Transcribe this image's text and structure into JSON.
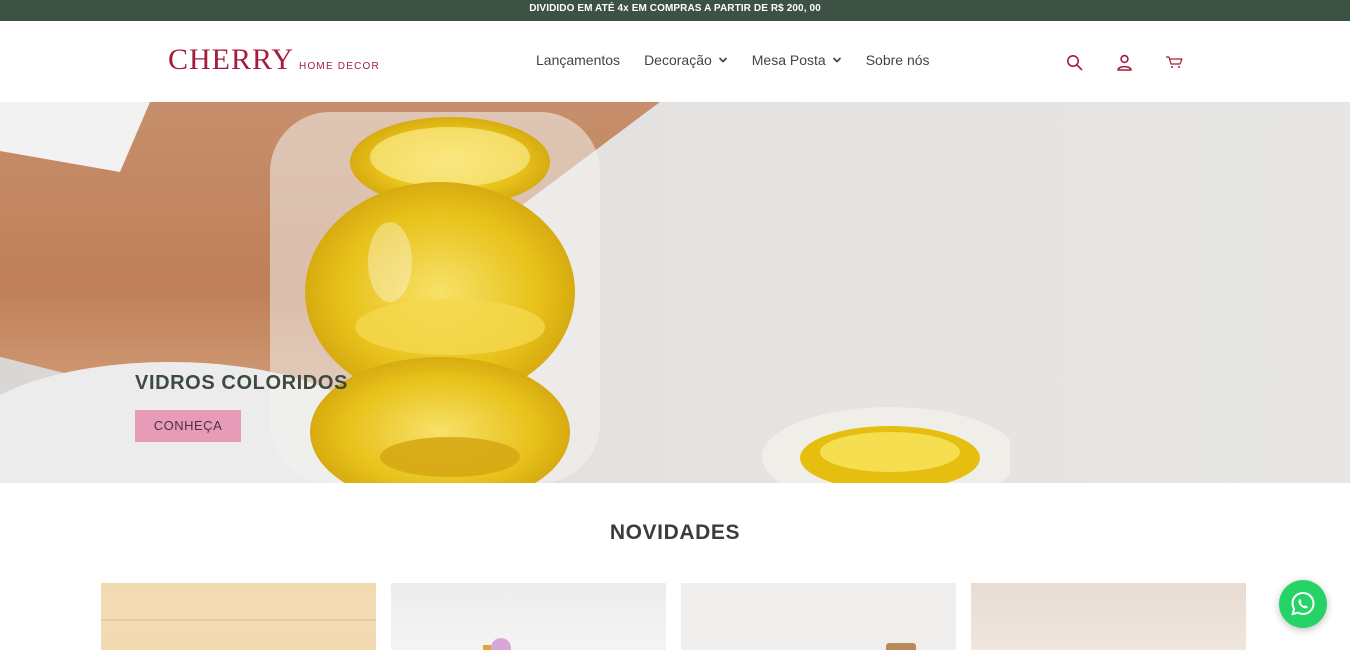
{
  "announcement": {
    "text": "DIVIDIDO EM ATÉ 4x EM COMPRAS A PARTIR DE R$ 200, 00"
  },
  "header": {
    "logo": {
      "main": "CHERRY",
      "sub": "HOME DECOR"
    },
    "nav": [
      {
        "label": "Lançamentos",
        "has_dropdown": false
      },
      {
        "label": "Decoração",
        "has_dropdown": true
      },
      {
        "label": "Mesa Posta",
        "has_dropdown": true
      },
      {
        "label": "Sobre nós",
        "has_dropdown": false
      }
    ],
    "icons": [
      "search-icon",
      "user-icon",
      "cart-icon"
    ]
  },
  "hero": {
    "title": "VIDROS COLORIDOS",
    "button_label": "CONHEÇA"
  },
  "section": {
    "title": "NOVIDADES"
  },
  "products": [
    {
      "name": "product-1",
      "image_tone": "#f1d9b0"
    },
    {
      "name": "product-2",
      "image_tone": "#ececec"
    },
    {
      "name": "product-3",
      "image_tone": "#f0efee"
    },
    {
      "name": "product-4",
      "image_tone": "#e8dcd2"
    }
  ],
  "colors": {
    "brand": "#a51d3c",
    "topbar": "#3d5144",
    "hero_button": "#e79bb6",
    "hero_title": "#3d4a3f",
    "whatsapp": "#25d366"
  },
  "floating": {
    "icon": "whatsapp-icon"
  }
}
